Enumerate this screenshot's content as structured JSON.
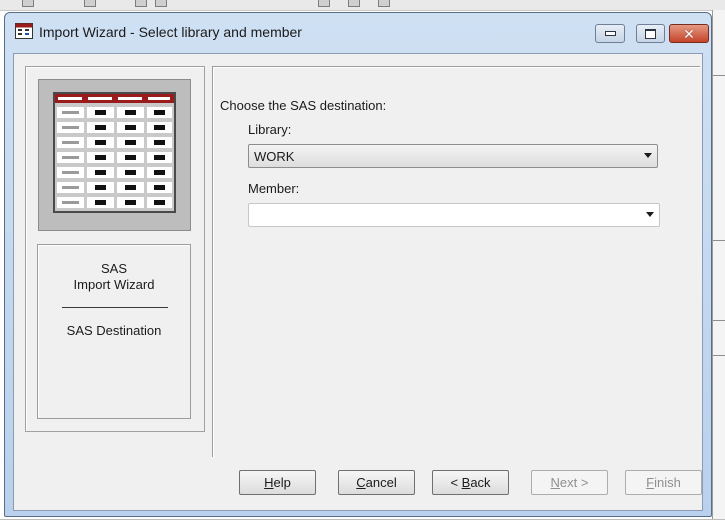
{
  "window": {
    "title": "Import Wizard - Select library and member"
  },
  "sidebar": {
    "line1": "SAS",
    "line2": "Import Wizard",
    "step": "SAS Destination"
  },
  "main": {
    "heading": "Choose the SAS destination:",
    "library_label": "Library:",
    "library_value": "WORK",
    "member_label": "Member:",
    "member_value": ""
  },
  "buttons": {
    "help": {
      "mnemonic": "H",
      "rest": "elp",
      "enabled": true
    },
    "cancel": {
      "mnemonic": "C",
      "rest": "ancel",
      "enabled": true
    },
    "back": {
      "prefix": "< ",
      "mnemonic": "B",
      "rest": "ack",
      "enabled": true
    },
    "next": {
      "mnemonic": "N",
      "rest": "ext >",
      "enabled": false
    },
    "finish": {
      "mnemonic": "F",
      "rest": "inish",
      "enabled": false
    }
  },
  "icons": [
    "wizard-app-icon",
    "minimize-icon",
    "maximize-icon",
    "close-icon",
    "spreadsheet-table-icon",
    "dropdown-arrow-icon"
  ],
  "colors": {
    "sheet_header": "#9a1b1b",
    "title_close": "#c5432a"
  }
}
